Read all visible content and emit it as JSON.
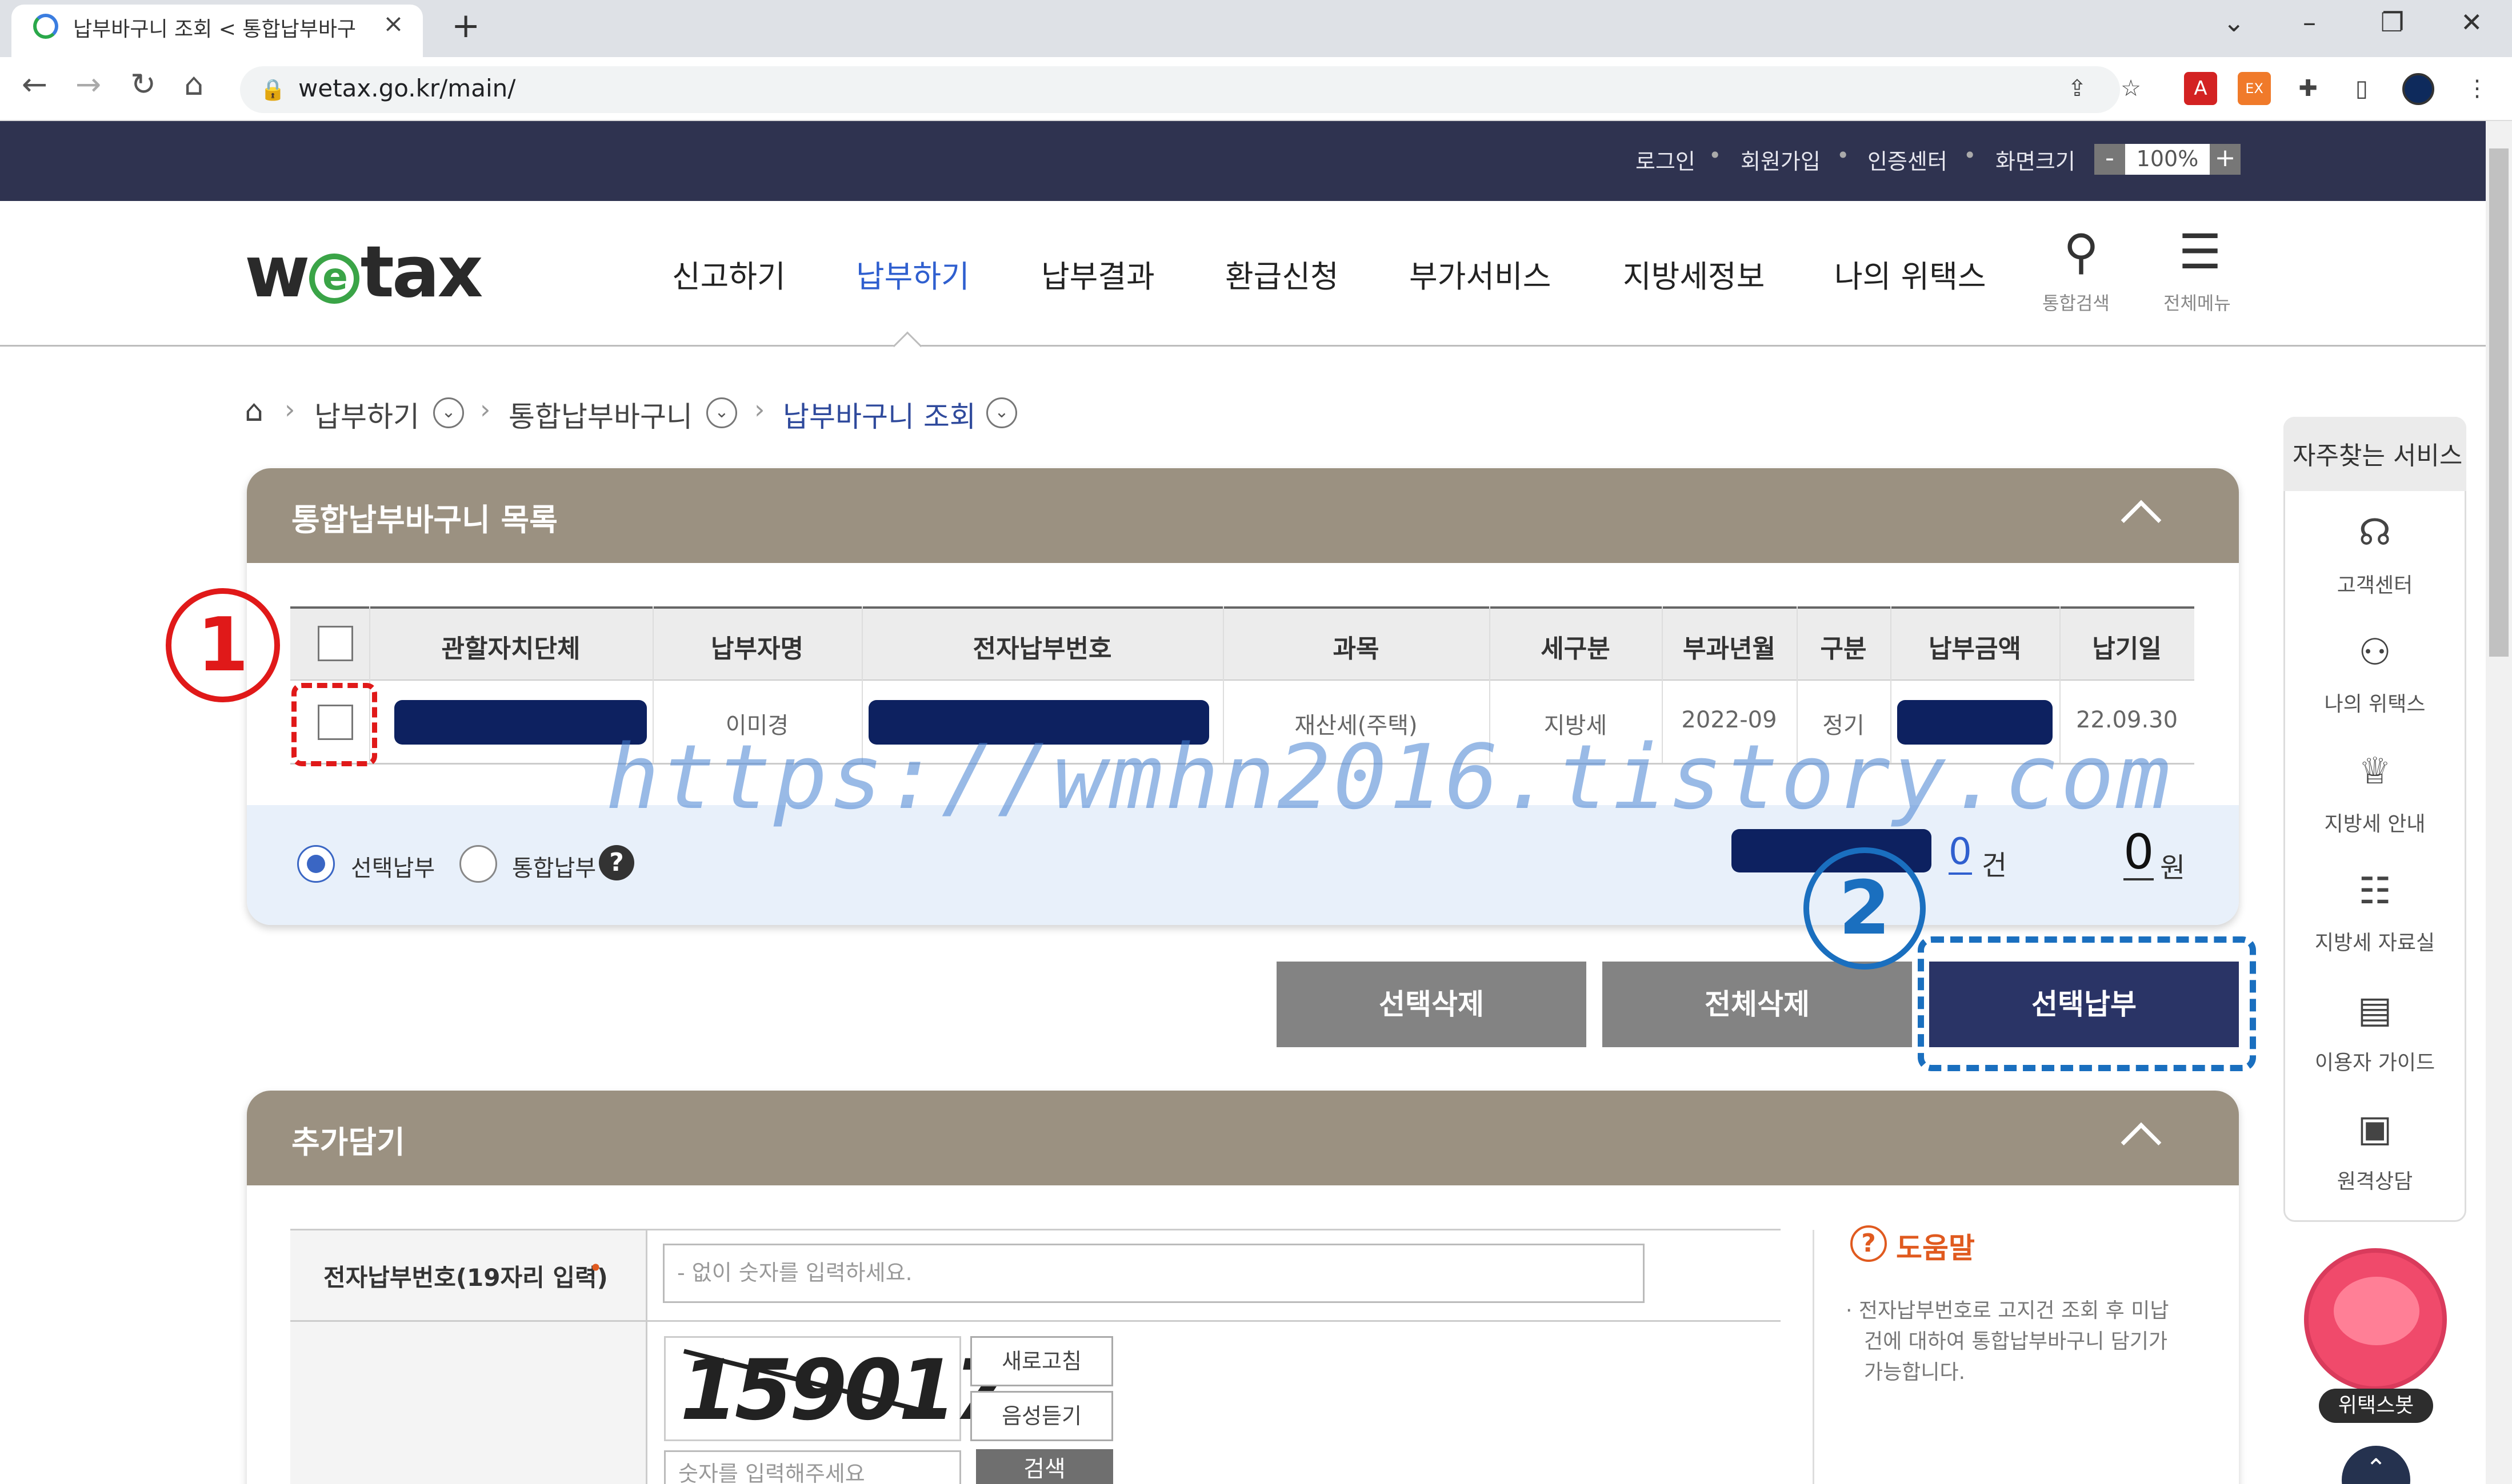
{
  "browser": {
    "tab_title": "납부바구니 조회 < 통합납부바구",
    "url": "wetax.go.kr/main/",
    "new_tab": "+"
  },
  "topbar": {
    "links": [
      "로그인",
      "회원가입",
      "인증센터",
      "화면크기"
    ],
    "zoom_minus": "-",
    "zoom_value": "100%",
    "zoom_plus": "+"
  },
  "logo": {
    "w": "w",
    "e": "e",
    "tax": "tax"
  },
  "gnb": {
    "items": [
      "신고하기",
      "납부하기",
      "납부결과",
      "환급신청",
      "부가서비스",
      "지방세정보",
      "나의 위택스"
    ],
    "active": "납부하기",
    "search_label": "통합검색",
    "menu_label": "전체메뉴"
  },
  "breadcrumb": [
    "납부하기",
    "통합납부바구니",
    "납부바구니 조회"
  ],
  "basket": {
    "title": "통합납부바구니 목록",
    "columns": [
      "관할자치단체",
      "납부자명",
      "전자납부번호",
      "과목",
      "세구분",
      "부과년월",
      "구분",
      "납부금액",
      "납기일"
    ],
    "row": {
      "payer": "이미경",
      "subject": "재산세(주택)",
      "tax_type": "지방세",
      "period": "2022-09",
      "kind": "정기",
      "due": "22.09.30"
    },
    "radio_select": "선택납부",
    "radio_combined": "통합납부",
    "help": "?",
    "count_value": "0",
    "count_unit": "건",
    "amount_value": "0",
    "amount_unit": "원"
  },
  "buttons": {
    "delete_selected": "선택삭제",
    "delete_all": "전체삭제",
    "pay_selected": "선택납부"
  },
  "add_panel": {
    "title": "추가담기",
    "field_label": "전자납부번호(19자리 입력)",
    "required": "•",
    "placeholder": "- 없이 숫자를 입력하세요.",
    "captcha": "159017",
    "refresh": "새로고침",
    "audio": "음성듣기",
    "captcha_placeholder": "숫자를 입력해주세요",
    "search": "검색",
    "help_title": "도움말",
    "help_lines": [
      "· 전자납부번호로 고지건 조회 후 미납",
      "건에 대하여 통합납부바구니 담기가",
      "가능합니다."
    ]
  },
  "quick": {
    "title": "자주찾는 서비스",
    "items": [
      "고객센터",
      "나의 위택스",
      "지방세 안내",
      "지방세 자료실",
      "이용자 가이드",
      "원격상담"
    ],
    "bot": "위택스봇"
  },
  "annotations": {
    "one": "1",
    "two": "2"
  },
  "watermark": "https://wmhn2016.tistory.com",
  "colors": {
    "header": "#2f3350",
    "panel_head": "#9b9181",
    "accent": "#2f5fcf",
    "navy_button": "#2a3466"
  }
}
